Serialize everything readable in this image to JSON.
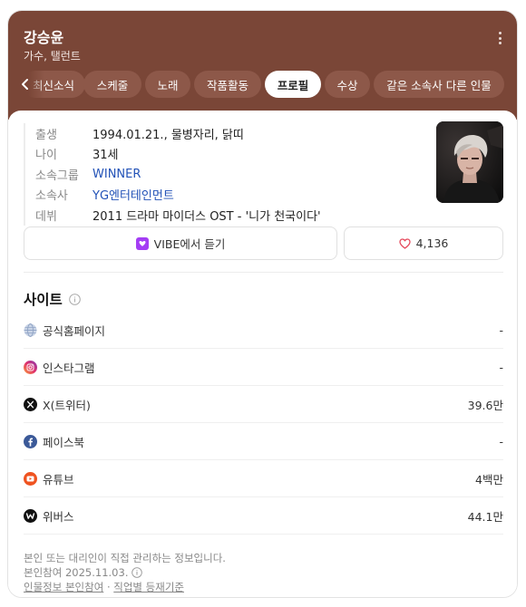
{
  "header": {
    "title": "강승윤",
    "subtitle": "가수, 탤런트"
  },
  "tabs": [
    {
      "label": "최신소식",
      "active": false
    },
    {
      "label": "스케줄",
      "active": false
    },
    {
      "label": "노래",
      "active": false
    },
    {
      "label": "작품활동",
      "active": false
    },
    {
      "label": "프로필",
      "active": true
    },
    {
      "label": "수상",
      "active": false
    },
    {
      "label": "같은 소속사 다른 인물",
      "active": false
    }
  ],
  "profile": {
    "rows": [
      {
        "label": "출생",
        "value": "1994.01.21., 물병자리, 닭띠"
      },
      {
        "label": "나이",
        "value": "31세"
      },
      {
        "label": "소속그룹",
        "value": "WINNER"
      },
      {
        "label": "소속사",
        "value": "YG엔터테인먼트"
      },
      {
        "label": "데뷔",
        "value": "2011 드라마 마이더스 OST - '니가 천국이다'"
      }
    ]
  },
  "actions": {
    "vibe_label": "VIBE에서 듣기",
    "like_count": "4,136"
  },
  "sites": {
    "title": "사이트",
    "items": [
      {
        "name": "공식홈페이지",
        "value": "-",
        "icon": "globe-icon"
      },
      {
        "name": "인스타그램",
        "value": "-",
        "icon": "instagram-icon"
      },
      {
        "name": "X(트위터)",
        "value": "39.6만",
        "icon": "x-icon"
      },
      {
        "name": "페이스북",
        "value": "-",
        "icon": "facebook-icon"
      },
      {
        "name": "유튜브",
        "value": "4백만",
        "icon": "youtube-icon"
      },
      {
        "name": "위버스",
        "value": "44.1만",
        "icon": "weverse-icon"
      }
    ]
  },
  "footer": {
    "notice": "본인 또는 대리인이 직접 관리하는 정보입니다.",
    "date": "본인참여 2025.11.03.",
    "link1": "인물정보 본인참여",
    "separator": "·",
    "link2": "직업별 등재기준"
  },
  "colors": {
    "header_bg": "#7a4637",
    "tab_bg": "#8d5849",
    "link": "#2252b7",
    "vibe": "#a43df4",
    "heart": "#e5485b"
  }
}
